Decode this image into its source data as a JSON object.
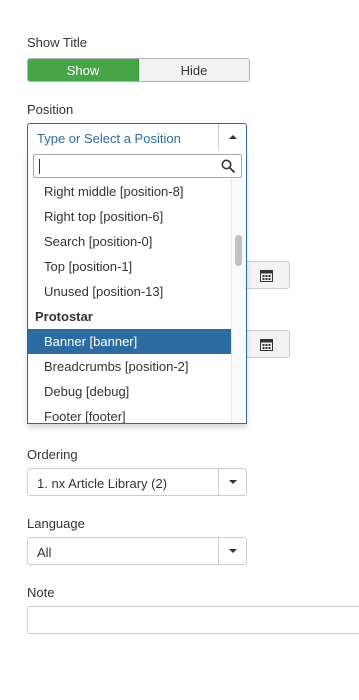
{
  "show_title": {
    "label": "Show Title",
    "options": [
      {
        "label": "Show",
        "active": true
      },
      {
        "label": "Hide",
        "active": false
      }
    ],
    "active_color": "#46a546"
  },
  "position": {
    "label": "Position",
    "placeholder": "Type or Select a Position",
    "search_value": "",
    "results": [
      {
        "text": "Right middle [position-8]",
        "type": "option"
      },
      {
        "text": "Right top [position-6]",
        "type": "option"
      },
      {
        "text": "Search [position-0]",
        "type": "option"
      },
      {
        "text": "Top [position-1]",
        "type": "option"
      },
      {
        "text": "Unused [position-13]",
        "type": "option"
      },
      {
        "text": "Protostar",
        "type": "group"
      },
      {
        "text": "Banner [banner]",
        "type": "option",
        "highlighted": true
      },
      {
        "text": "Breadcrumbs [position-2]",
        "type": "option"
      },
      {
        "text": "Debug [debug]",
        "type": "option"
      },
      {
        "text": "Footer [footer]",
        "type": "option"
      }
    ],
    "highlight_color": "#2d6ca2"
  },
  "ordering": {
    "label": "Ordering",
    "value": "1. nx Article Library (2)"
  },
  "language": {
    "label": "Language",
    "value": "All"
  },
  "note": {
    "label": "Note",
    "value": ""
  }
}
